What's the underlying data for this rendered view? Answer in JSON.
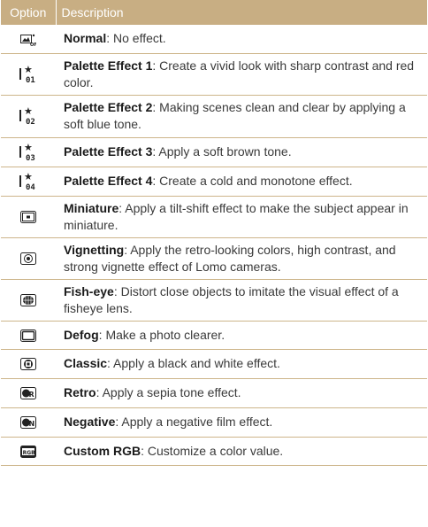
{
  "header": {
    "option": "Option",
    "description": "Description"
  },
  "rows": [
    {
      "icon": "normal-off-icon",
      "name": "Normal",
      "text": ": No effect."
    },
    {
      "icon": "palette-1-icon",
      "name": "Palette Effect 1",
      "text": ": Create a vivid look with sharp contrast and red color.",
      "num": "01"
    },
    {
      "icon": "palette-2-icon",
      "name": "Palette Effect 2",
      "text": ": Making scenes clean and clear by applying a soft blue tone.",
      "num": "02"
    },
    {
      "icon": "palette-3-icon",
      "name": "Palette Effect 3",
      "text": ": Apply a soft brown tone.",
      "num": "03"
    },
    {
      "icon": "palette-4-icon",
      "name": "Palette Effect 4",
      "text": ": Create a cold and monotone effect.",
      "num": "04"
    },
    {
      "icon": "miniature-icon",
      "name": "Miniature",
      "text": ": Apply a tilt-shift effect to make the subject appear in miniature."
    },
    {
      "icon": "vignetting-icon",
      "name": "Vignetting",
      "text": ": Apply the retro-looking colors, high contrast, and strong vignette effect of Lomo cameras."
    },
    {
      "icon": "fish-eye-icon",
      "name": "Fish-eye",
      "text": ": Distort close objects to imitate the visual effect of a fisheye lens."
    },
    {
      "icon": "defog-icon",
      "name": "Defog",
      "text": ": Make a photo clearer."
    },
    {
      "icon": "classic-icon",
      "name": "Classic",
      "text": ": Apply a black and white effect."
    },
    {
      "icon": "retro-icon",
      "name": "Retro",
      "text": ": Apply a sepia tone effect."
    },
    {
      "icon": "negative-icon",
      "name": "Negative",
      "text": ": Apply a negative film effect."
    },
    {
      "icon": "custom-rgb-icon",
      "name": "Custom RGB",
      "text": ": Customize a color value."
    }
  ]
}
